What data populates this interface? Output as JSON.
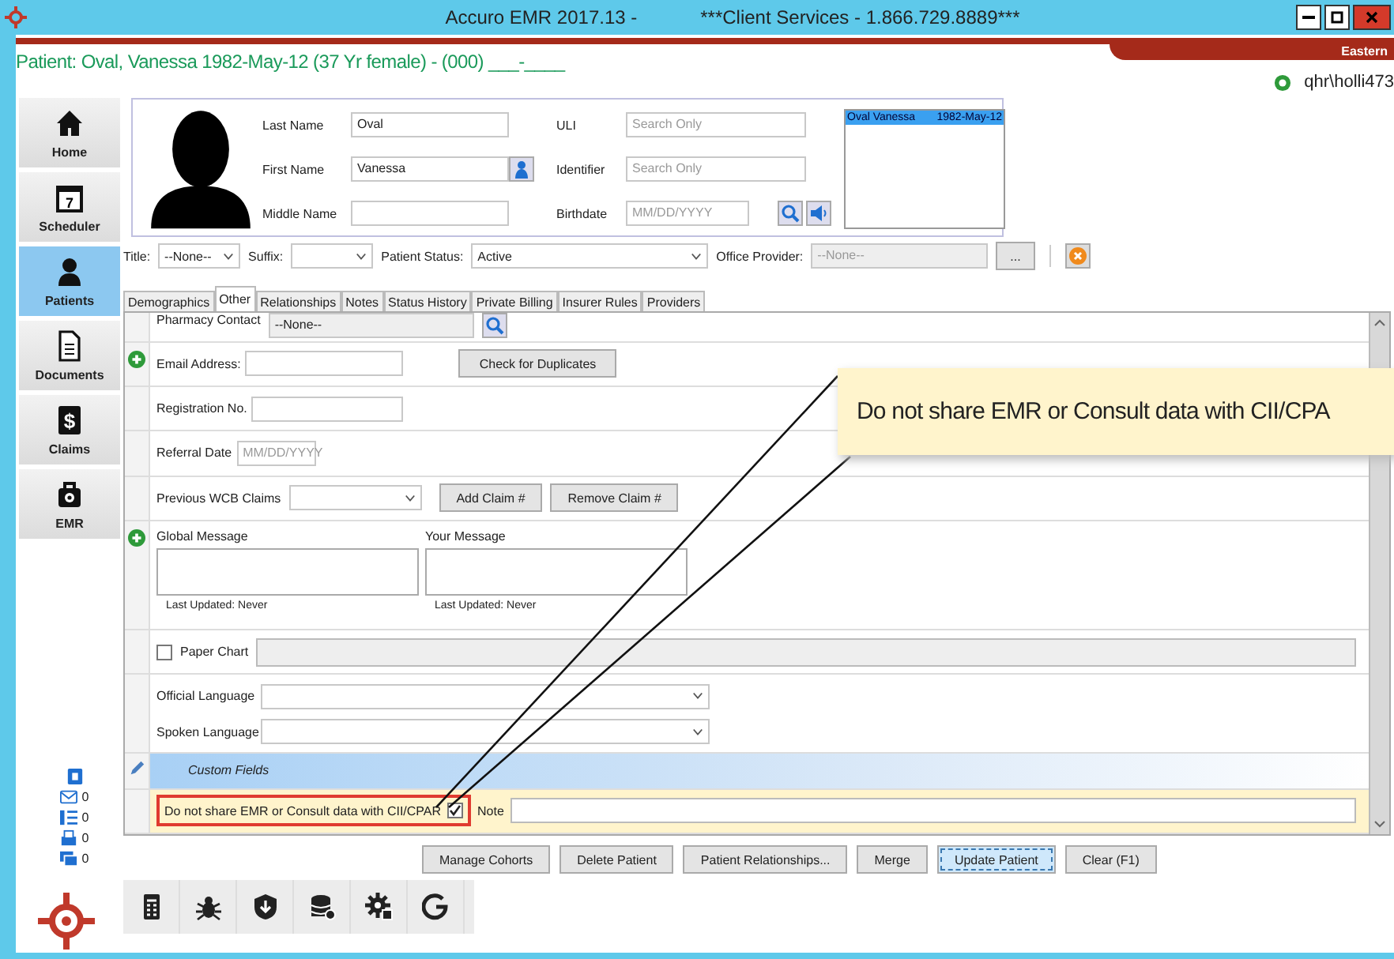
{
  "window": {
    "title": "Accuro EMR 2017.13 -",
    "subtitle": "***Client Services - 1.866.729.8889***"
  },
  "patient_banner": "Patient: Oval, Vanessa 1982-May-12 (37 Yr female) - (000) ___-____",
  "timezone": "Eastern",
  "user": "qhr\\holli473",
  "nav": [
    {
      "label": "Home",
      "selected": false
    },
    {
      "label": "Scheduler",
      "selected": false,
      "icon_text": "7"
    },
    {
      "label": "Patients",
      "selected": true
    },
    {
      "label": "Documents",
      "selected": false
    },
    {
      "label": "Claims",
      "selected": false,
      "icon_text": "$"
    },
    {
      "label": "EMR",
      "selected": false
    }
  ],
  "counters": [
    "0",
    "0",
    "0",
    "0"
  ],
  "identity": {
    "left": [
      {
        "label": "Last Name",
        "value": "Oval"
      },
      {
        "label": "First Name",
        "value": "Vanessa"
      },
      {
        "label": "Middle Name"
      }
    ],
    "right": [
      {
        "label": "ULI",
        "placeholder": "Search Only"
      },
      {
        "label": "Identifier",
        "placeholder": "Search Only"
      },
      {
        "label": "Birthdate",
        "placeholder": "MM/DD/YYYY"
      }
    ],
    "matches": [
      {
        "name": "Oval  Vanessa",
        "birthdate": "1982-May-12",
        "selected": true
      }
    ]
  },
  "status_row": {
    "title": {
      "label": "Title:",
      "value": "--None--"
    },
    "suffix": {
      "label": "Suffix:"
    },
    "patient_status": {
      "label": "Patient Status:",
      "value": "Active"
    },
    "office_provider": {
      "label": "Office Provider:",
      "placeholder": "--None--"
    },
    "browse_button": "..."
  },
  "tabs": [
    {
      "label": "Demographics",
      "selected": false
    },
    {
      "label": "Other",
      "selected": true
    },
    {
      "label": "Relationships",
      "selected": false
    },
    {
      "label": "Notes",
      "selected": false
    },
    {
      "label": "Status History",
      "selected": false
    },
    {
      "label": "Private Billing",
      "selected": false
    },
    {
      "label": "Insurer Rules",
      "selected": false
    },
    {
      "label": "Providers",
      "selected": false
    }
  ],
  "form_rows": [
    {
      "kind": "lookup",
      "add": false,
      "label": "Pharmacy Contact",
      "value": "--None--"
    },
    {
      "kind": "text",
      "add": true,
      "label": "Email Address:",
      "button": "Check for Duplicates"
    },
    {
      "kind": "text",
      "add": false,
      "label": "Registration No."
    },
    {
      "kind": "date",
      "add": false,
      "label": "Referral Date",
      "placeholder": "MM/DD/YYYY"
    },
    {
      "kind": "combo",
      "add": false,
      "label": "Previous WCB Claims",
      "buttons": [
        "Add Claim #",
        "Remove Claim #"
      ]
    },
    {
      "kind": "messages",
      "add": true,
      "messages": [
        {
          "label": "Global Message",
          "updated": "Last Updated: Never"
        },
        {
          "label": "Your Message",
          "updated": "Last Updated: Never"
        }
      ]
    },
    {
      "kind": "checkbox",
      "add": false,
      "label": "Paper Chart",
      "checked": false
    },
    {
      "kind": "languages",
      "add": false,
      "items": [
        "Official Language",
        "Spoken Language"
      ]
    },
    {
      "kind": "section",
      "add": false,
      "label": "Custom Fields"
    },
    {
      "kind": "custom",
      "add": false,
      "label": "Do not share EMR or Consult data with CII/CPAR",
      "checked": true,
      "highlighted": true,
      "note_label": "Note"
    }
  ],
  "actions": [
    {
      "label": "Manage Cohorts",
      "focused": false
    },
    {
      "label": "Delete Patient",
      "focused": false
    },
    {
      "label": "Patient Relationships...",
      "focused": false
    },
    {
      "label": "Merge",
      "focused": false
    },
    {
      "label": "Update Patient",
      "focused": true
    },
    {
      "label": "Clear (F1)",
      "focused": false
    }
  ],
  "callout": "Do not share EMR or Consult data with CII/CPA"
}
